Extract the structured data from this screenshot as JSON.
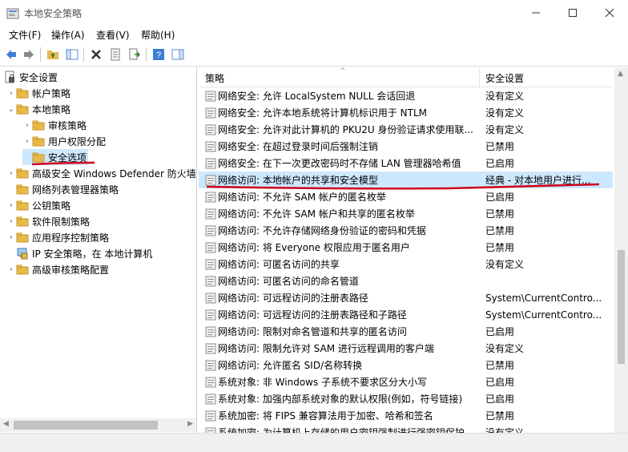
{
  "window": {
    "title": "本地安全策略"
  },
  "menu": [
    "文件(F)",
    "操作(A)",
    "查看(V)",
    "帮助(H)"
  ],
  "tree": {
    "root": "安全设置",
    "items": [
      {
        "label": "帐户策略",
        "level": 1,
        "expand": "collapsed"
      },
      {
        "label": "本地策略",
        "level": 1,
        "expand": "expanded"
      },
      {
        "label": "审核策略",
        "level": 2,
        "expand": "collapsed"
      },
      {
        "label": "用户权限分配",
        "level": 2,
        "expand": "collapsed"
      },
      {
        "label": "安全选项",
        "level": 2,
        "expand": "none",
        "selected": true
      },
      {
        "label": "高级安全 Windows Defender 防火墙",
        "level": 1,
        "expand": "collapsed"
      },
      {
        "label": "网络列表管理器策略",
        "level": 1,
        "expand": "none"
      },
      {
        "label": "公钥策略",
        "level": 1,
        "expand": "collapsed"
      },
      {
        "label": "软件限制策略",
        "level": 1,
        "expand": "collapsed"
      },
      {
        "label": "应用程序控制策略",
        "level": 1,
        "expand": "collapsed"
      },
      {
        "label": "IP 安全策略，在 本地计算机",
        "level": 1,
        "expand": "none",
        "icon": "ip-security"
      },
      {
        "label": "高级审核策略配置",
        "level": 1,
        "expand": "collapsed"
      }
    ]
  },
  "list": {
    "columns": {
      "policy": "策略",
      "setting": "安全设置"
    },
    "rows": [
      {
        "name": "网络安全: 允许 LocalSystem NULL 会话回退",
        "value": "没有定义"
      },
      {
        "name": "网络安全: 允许本地系统将计算机标识用于 NTLM",
        "value": "没有定义"
      },
      {
        "name": "网络安全: 允许对此计算机的 PKU2U 身份验证请求使用联...",
        "value": "没有定义"
      },
      {
        "name": "网络安全: 在超过登录时间后强制注销",
        "value": "已禁用"
      },
      {
        "name": "网络安全: 在下一次更改密码时不存储 LAN 管理器哈希值",
        "value": "已启用"
      },
      {
        "name": "网络访问: 本地帐户的共享和安全模型",
        "value": "经典 - 对本地用户进行...",
        "selected": true
      },
      {
        "name": "网络访问: 不允许 SAM 帐户的匿名枚举",
        "value": "已启用"
      },
      {
        "name": "网络访问: 不允许 SAM 帐户和共享的匿名枚举",
        "value": "已禁用"
      },
      {
        "name": "网络访问: 不允许存储网络身份验证的密码和凭据",
        "value": "已禁用"
      },
      {
        "name": "网络访问: 将 Everyone 权限应用于匿名用户",
        "value": "已禁用"
      },
      {
        "name": "网络访问: 可匿名访问的共享",
        "value": "没有定义"
      },
      {
        "name": "网络访问: 可匿名访问的命名管道",
        "value": ""
      },
      {
        "name": "网络访问: 可远程访问的注册表路径",
        "value": "System\\CurrentContro..."
      },
      {
        "name": "网络访问: 可远程访问的注册表路径和子路径",
        "value": "System\\CurrentContro..."
      },
      {
        "name": "网络访问: 限制对命名管道和共享的匿名访问",
        "value": "已启用"
      },
      {
        "name": "网络访问: 限制允许对 SAM 进行远程调用的客户端",
        "value": "没有定义"
      },
      {
        "name": "网络访问: 允许匿名 SID/名称转换",
        "value": "已禁用"
      },
      {
        "name": "系统对象: 非 Windows 子系统不要求区分大小写",
        "value": "已启用"
      },
      {
        "name": "系统对象: 加强内部系统对象的默认权限(例如，符号链接)",
        "value": "已启用"
      },
      {
        "name": "系统加密: 将 FIPS 兼容算法用于加密、哈希和签名",
        "value": "已禁用"
      },
      {
        "name": "系统加密: 为计算机上存储的用户密钥强制进行强密钥保护",
        "value": "没有定义"
      }
    ]
  },
  "colors": {
    "annotation": "#d0021b",
    "folder": "#e8b949",
    "selection": "#cce8ff"
  }
}
